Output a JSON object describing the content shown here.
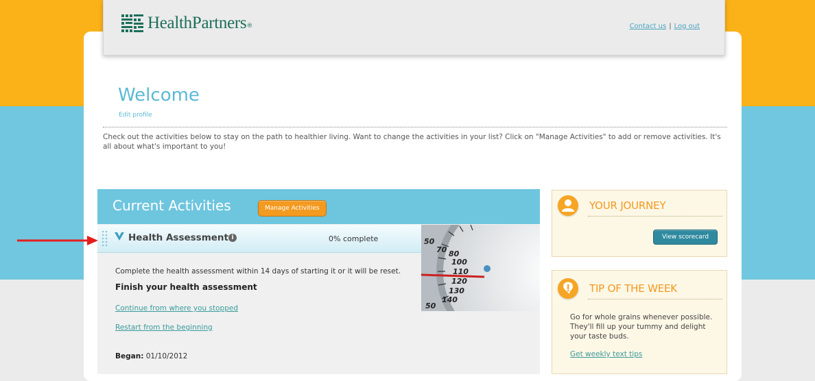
{
  "brand": {
    "name": "HealthPartners",
    "trademark": "®"
  },
  "header": {
    "contact_label": "Contact us",
    "separator": "|",
    "logout_label": "Log out"
  },
  "welcome": {
    "title": "Welcome",
    "edit_profile_label": "Edit profile",
    "intro": "Check out the activities below to stay on the path to healthier living. Want to change the activities in your list? Click on \"Manage Activities\" to add or remove activities. It's all about what's important to you!"
  },
  "activities": {
    "title": "Current Activities",
    "manage_label": "Manage Activities",
    "item": {
      "title": "Health Assessment",
      "progress_text": "0% complete",
      "progress_value": 0,
      "note": "Complete the health assessment within 14 days of starting it or it will be reset.",
      "heading": "Finish your health assessment",
      "continue_label": "Continue from where you stopped",
      "restart_label": "Restart from the beginning",
      "began_label": "Began:",
      "began_date": "01/10/2012"
    }
  },
  "journey": {
    "title": "YOUR JOURNEY",
    "button_label": "View scorecard"
  },
  "tip": {
    "title": "TIP OF THE WEEK",
    "text": "Go for whole grains whenever possible. They'll fill up your tummy and delight your taste buds.",
    "link_label": "Get weekly text tips"
  },
  "colors": {
    "orange_bg": "#fbb118",
    "blue_bg": "#71c7df",
    "accent_blue": "#5bb9d4",
    "accent_orange": "#f39a20",
    "brand_green": "#1d6f5a",
    "annotation_red": "#e41e1e"
  },
  "icons": {
    "logo": "healthpartners-logo-icon",
    "drag": "drag-handle-icon",
    "chevron": "chevron-down-icon",
    "info": "info-icon",
    "journey": "person-icon",
    "tip": "exclamation-icon",
    "annotation": "red-arrow-icon"
  }
}
